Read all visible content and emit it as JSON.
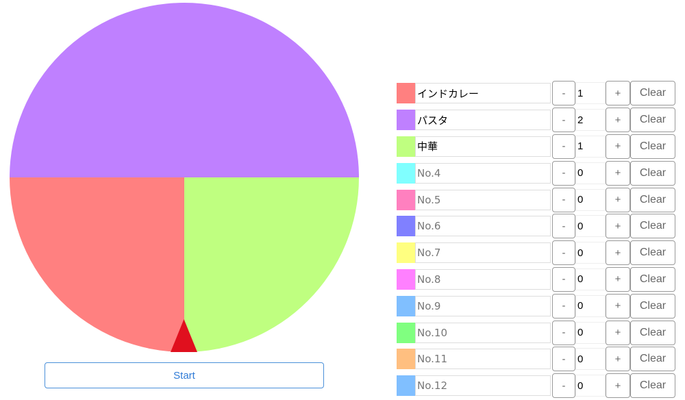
{
  "start_label": "Start",
  "pointer_color": "#e0101e",
  "items": [
    {
      "name": "インドカレー",
      "placeholder": "No.1",
      "count": "1",
      "color": "#ff8080"
    },
    {
      "name": "パスタ",
      "placeholder": "No.2",
      "count": "2",
      "color": "#bf80ff"
    },
    {
      "name": "中華",
      "placeholder": "No.3",
      "count": "1",
      "color": "#bfff80"
    },
    {
      "name": "",
      "placeholder": "No.4",
      "count": "0",
      "color": "#80ffff"
    },
    {
      "name": "",
      "placeholder": "No.5",
      "count": "0",
      "color": "#ff80bf"
    },
    {
      "name": "",
      "placeholder": "No.6",
      "count": "0",
      "color": "#8080ff"
    },
    {
      "name": "",
      "placeholder": "No.7",
      "count": "0",
      "color": "#ffff80"
    },
    {
      "name": "",
      "placeholder": "No.8",
      "count": "0",
      "color": "#ff80ff"
    },
    {
      "name": "",
      "placeholder": "No.9",
      "count": "0",
      "color": "#80bfff"
    },
    {
      "name": "",
      "placeholder": "No.10",
      "count": "0",
      "color": "#80ff80"
    },
    {
      "name": "",
      "placeholder": "No.11",
      "count": "0",
      "color": "#ffbf80"
    },
    {
      "name": "",
      "placeholder": "No.12",
      "count": "0",
      "color": "#80bfff"
    }
  ],
  "minus_label": "-",
  "plus_label": "+",
  "clear_label": "Clear"
}
